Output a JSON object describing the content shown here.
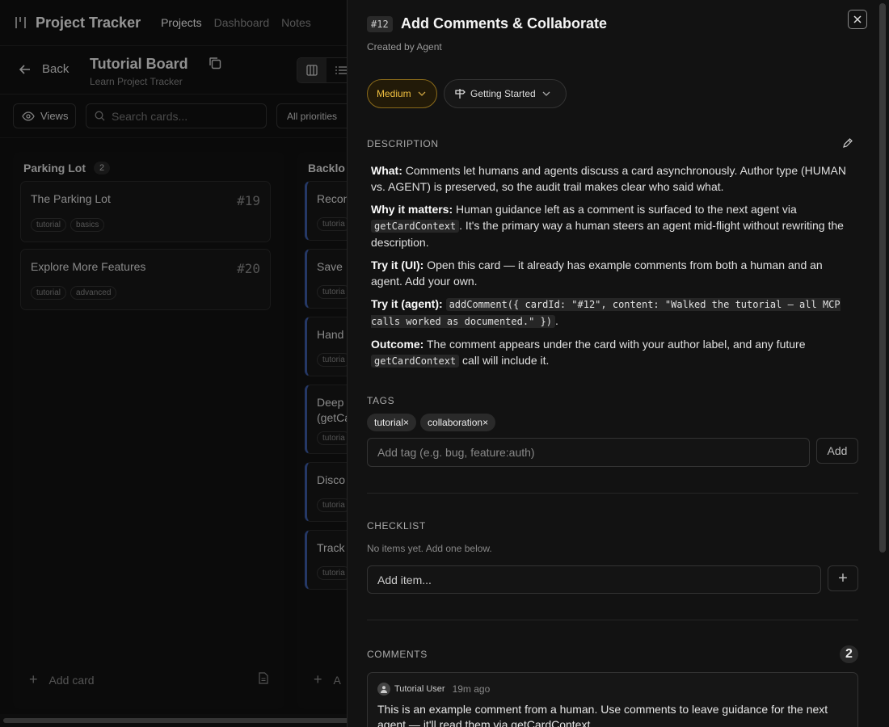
{
  "app": {
    "title": "Project Tracker",
    "nav": [
      "Projects",
      "Dashboard",
      "Notes"
    ]
  },
  "board": {
    "back_label": "Back",
    "title": "Tutorial Board",
    "subtitle": "Learn Project Tracker"
  },
  "filters": {
    "views_label": "Views",
    "search_placeholder": "Search cards...",
    "priority_selected": "All priorities"
  },
  "columns": {
    "parking": {
      "name": "Parking Lot",
      "count": "2",
      "cards": [
        {
          "title": "The Parking Lot",
          "number": "#19",
          "tags": [
            "tutorial",
            "basics"
          ]
        },
        {
          "title": "Explore More Features",
          "number": "#20",
          "tags": [
            "tutorial",
            "advanced"
          ]
        }
      ],
      "add_label": "Add card"
    },
    "backlog": {
      "name": "Backlo",
      "cards": [
        {
          "title": "Recon",
          "tag": "tutoria"
        },
        {
          "title": "Save",
          "tag": "tutoria"
        },
        {
          "title": "Hand",
          "tag": "tutoria"
        },
        {
          "title": "Deep",
          "title2": "(getCa",
          "tag": "tutoria"
        },
        {
          "title": "Disco",
          "tag": "tutoria"
        },
        {
          "title": "Track",
          "tag": "tutoria"
        }
      ],
      "add_label": "A"
    }
  },
  "panel": {
    "card_id": "#12",
    "title": "Add Comments & Collaborate",
    "created_by": "Created by Agent",
    "priority": "Medium",
    "category": "Getting Started",
    "description_label": "DESCRIPTION",
    "description": {
      "what_label": "What:",
      "what_text": " Comments let humans and agents discuss a card asynchronously. Author type (HUMAN vs. AGENT) is preserved, so the audit trail makes clear who said what.",
      "why_label": "Why it matters:",
      "why_text1": " Human guidance left as a comment is surfaced to the next agent via ",
      "why_code": "getCardContext",
      "why_text2": ". It's the primary way a human steers an agent mid-flight without rewriting the description.",
      "ui_label": "Try it (UI):",
      "ui_text": " Open this card — it already has example comments from both a human and an agent. Add your own.",
      "agent_label": "Try it (agent):",
      "agent_code": "addComment({ cardId: \"#12\", content: \"Walked the tutorial — all MCP calls worked as documented.\" })",
      "agent_text": ".",
      "outcome_label": "Outcome:",
      "outcome_text1": " The comment appears under the card with your author label, and any future ",
      "outcome_code": "getCardContext",
      "outcome_text2": " call will include it."
    },
    "tags_label": "TAGS",
    "tags": [
      "tutorial×",
      "collaboration×"
    ],
    "tag_input_placeholder": "Add tag (e.g. bug, feature:auth)",
    "add_tag_label": "Add",
    "checklist_label": "CHECKLIST",
    "checklist_empty": "No items yet. Add one below.",
    "checklist_placeholder": "Add item...",
    "comments_label": "COMMENTS",
    "comments_count": "2",
    "comment": {
      "author": "Tutorial User",
      "time": "19m ago",
      "text": "This is an example comment from a human. Use comments to leave guidance for the next agent — it'll read them via getCardContext."
    }
  },
  "colors": {
    "accent_priority": "#f0c040",
    "backlog_border": "#3b5ba5",
    "panel_bg": "#121212"
  },
  "icons": [
    "logo-icon",
    "arrow-left-icon",
    "copy-icon",
    "columns-icon",
    "list-icon",
    "eye-icon",
    "search-icon",
    "plus-icon",
    "document-icon",
    "close-icon",
    "chevron-down-icon",
    "signpost-icon",
    "pencil-icon",
    "user-icon"
  ]
}
